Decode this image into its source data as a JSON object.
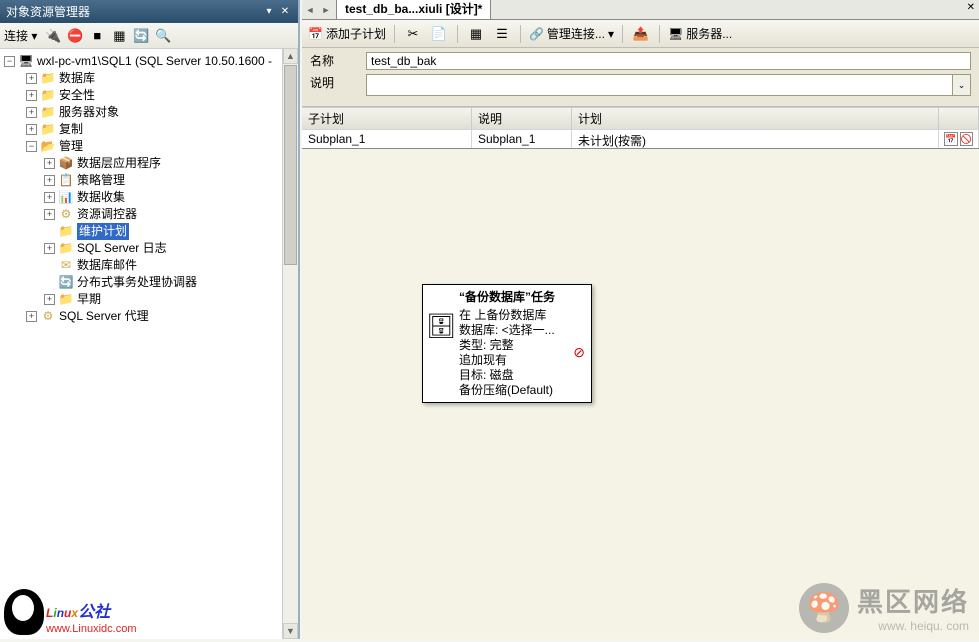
{
  "left_panel": {
    "title": "对象资源管理器",
    "toolbar": {
      "connect_label": "连接 ▾"
    },
    "tree": {
      "root": "wxl-pc-vm1\\SQL1 (SQL Server 10.50.1600 -",
      "nodes": [
        {
          "label": "数据库",
          "level": 1,
          "exp": "+",
          "icon": "📁"
        },
        {
          "label": "安全性",
          "level": 1,
          "exp": "+",
          "icon": "📁"
        },
        {
          "label": "服务器对象",
          "level": 1,
          "exp": "+",
          "icon": "📁"
        },
        {
          "label": "复制",
          "level": 1,
          "exp": "+",
          "icon": "📁"
        },
        {
          "label": "管理",
          "level": 1,
          "exp": "−",
          "icon": "📂"
        },
        {
          "label": "数据层应用程序",
          "level": 2,
          "exp": "+",
          "icon": "📦"
        },
        {
          "label": "策略管理",
          "level": 2,
          "exp": "+",
          "icon": "📋"
        },
        {
          "label": "数据收集",
          "level": 2,
          "exp": "+",
          "icon": "📊"
        },
        {
          "label": "资源调控器",
          "level": 2,
          "exp": "+",
          "icon": "⚙"
        },
        {
          "label": "维护计划",
          "level": 2,
          "exp": "",
          "icon": "📁",
          "selected": true
        },
        {
          "label": "SQL Server 日志",
          "level": 2,
          "exp": "+",
          "icon": "📁"
        },
        {
          "label": "数据库邮件",
          "level": 2,
          "exp": "",
          "icon": "✉"
        },
        {
          "label": "分布式事务处理协调器",
          "level": 2,
          "exp": "",
          "icon": "🔄"
        },
        {
          "label": "早期",
          "level": 2,
          "exp": "+",
          "icon": "📁"
        },
        {
          "label": "SQL Server 代理",
          "level": 1,
          "exp": "+",
          "icon": "⚙"
        }
      ]
    }
  },
  "right_panel": {
    "tab_title": "test_db_ba...xiuli [设计]*",
    "toolbar": {
      "add_subplan": "添加子计划",
      "manage_connections": "管理连接...",
      "servers": "服务器..."
    },
    "form": {
      "name_label": "名称",
      "name_value": "test_db_bak",
      "desc_label": "说明",
      "desc_value": ""
    },
    "grid": {
      "headers": [
        "子计划",
        "说明",
        "计划"
      ],
      "row": {
        "subplan": "Subplan_1",
        "desc": "Subplan_1",
        "schedule": "未计划(按需)"
      }
    },
    "task_box": {
      "title": "“备份数据库”任务",
      "lines": [
        "在  上备份数据库",
        "数据库: <选择一...",
        "类型: 完整",
        "追加现有",
        "目标: 磁盘",
        "备份压缩(Default)"
      ]
    }
  },
  "watermarks": {
    "left_text": "Linux公社",
    "left_url": "www.Linuxidc.com",
    "right_text": "黑区网络",
    "right_url": "www. heiqu. com"
  }
}
